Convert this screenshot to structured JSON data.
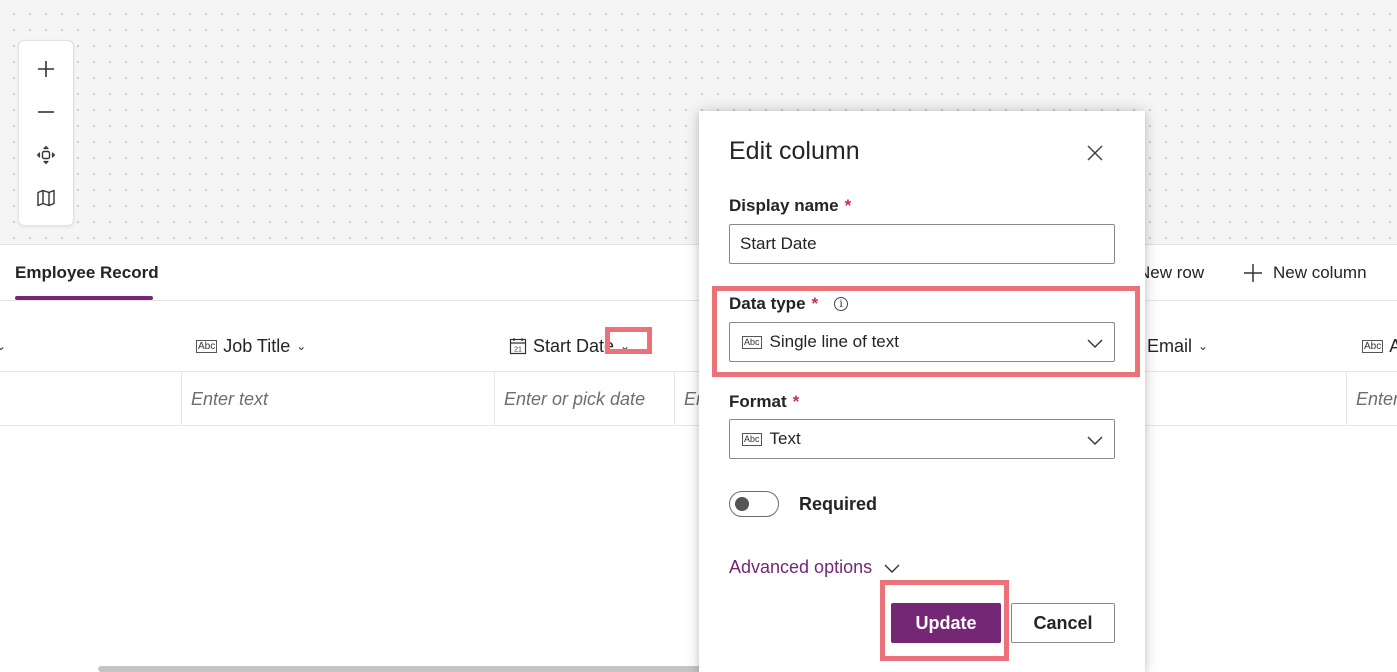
{
  "canvas": {
    "zoom_toolbar": [
      {
        "name": "zoom-in-icon"
      },
      {
        "name": "zoom-out-icon"
      },
      {
        "name": "fit-to-screen-icon"
      },
      {
        "name": "map-icon"
      }
    ]
  },
  "tabbar": {
    "active_tab": "Employee Record",
    "new_row_label": "New row",
    "new_row_icon": "plus-icon",
    "new_column_label": "New column",
    "new_column_icon": "plus-icon"
  },
  "grid": {
    "columns": [
      {
        "label": "Job Title",
        "icon": "text-icon"
      },
      {
        "label": "Start Date",
        "icon": "calendar-icon",
        "calendar_day": "21"
      },
      {
        "label": "Email",
        "icon": "text-icon"
      },
      {
        "label": "A",
        "icon": "text-icon"
      }
    ],
    "placeholders": [
      "Enter text",
      "Enter or pick date",
      "En",
      "Enter"
    ]
  },
  "panel": {
    "title": "Edit column",
    "display_name_label": "Display name",
    "display_name_value": "Start Date",
    "required_marker": "*",
    "data_type_label": "Data type",
    "data_type_info": "i",
    "data_type_value": "Single line of text",
    "format_label": "Format",
    "format_value": "Text",
    "text_icon_glyph": "Abc",
    "required_toggle_label": "Required",
    "required_toggle_on": false,
    "advanced_options_label": "Advanced options",
    "update_label": "Update",
    "cancel_label": "Cancel"
  },
  "colors": {
    "accent": "#742774",
    "highlight": "#ec7179",
    "required": "#c4314b"
  }
}
